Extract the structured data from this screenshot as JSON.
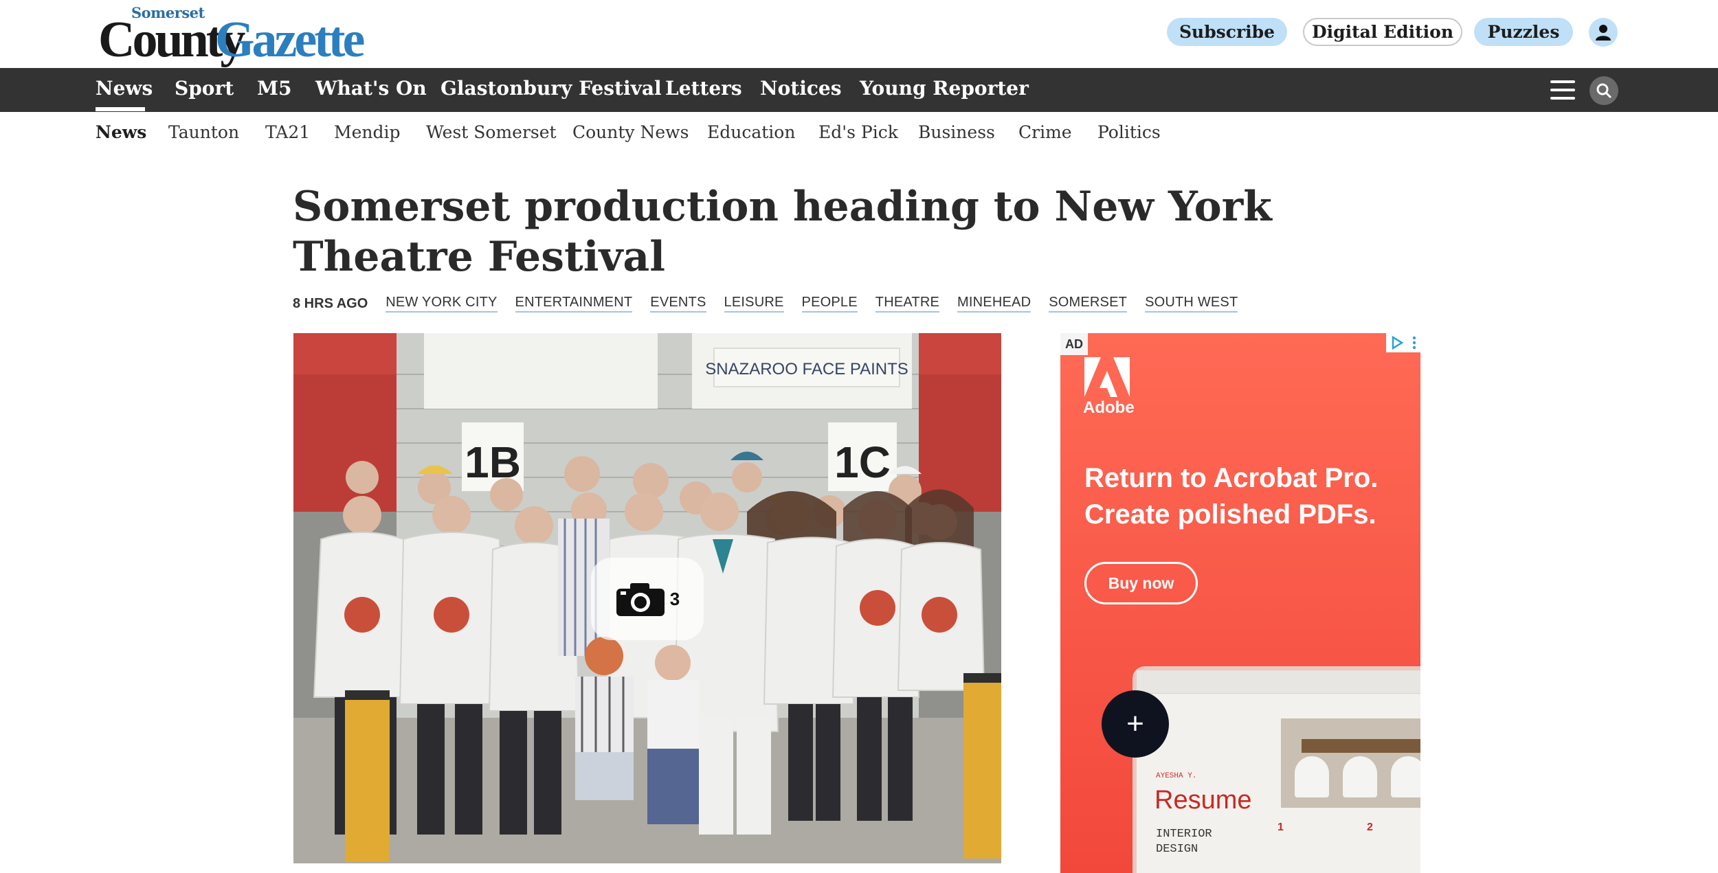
{
  "header": {
    "logo": {
      "top_word": "Somerset",
      "word1": "County",
      "word2": "Gazette"
    },
    "buttons": {
      "subscribe": "Subscribe",
      "digital_edition": "Digital Edition",
      "puzzles": "Puzzles"
    }
  },
  "main_nav": {
    "items": [
      "News",
      "Sport",
      "M5",
      "What's On",
      "Glastonbury Festival",
      "Letters",
      "Notices",
      "Young Reporter"
    ],
    "active": "News"
  },
  "sub_nav": {
    "items": [
      "News",
      "Taunton",
      "TA21",
      "Mendip",
      "West Somerset",
      "County News",
      "Education",
      "Ed's Pick",
      "Business",
      "Crime",
      "Politics"
    ],
    "active": "News"
  },
  "article": {
    "headline": "Somerset production heading to New York Theatre Festival",
    "time": "8 HRS AGO",
    "tags": [
      "NEW YORK CITY",
      "ENTERTAINMENT",
      "EVENTS",
      "LEISURE",
      "PEOPLE",
      "THEATRE",
      "MINEHEAD",
      "SOMERSET",
      "SOUTH WEST"
    ],
    "photo": {
      "sign_text": "SNAZAROO FACE PAINTS",
      "bay_left": "1B",
      "bay_right": "1C",
      "gallery_count": "3"
    }
  },
  "ad": {
    "label": "AD",
    "brand": "Adobe",
    "headline": "Return to Acrobat Pro. Create polished PDFs.",
    "cta": "Buy now",
    "resume_name": "AYESHA Y.",
    "resume_title": "Resume",
    "resume_sub": "INTERIOR DESIGN",
    "resume_nums": [
      "1",
      "2"
    ]
  },
  "colors": {
    "nav_bg": "#333333",
    "accent_blue": "#bfe0f7",
    "ad_red": "#f2483c",
    "logo_blue": "#2c7fbf"
  }
}
